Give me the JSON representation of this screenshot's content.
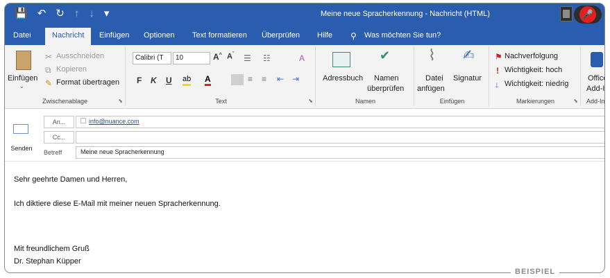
{
  "window": {
    "title": "Meine neue Spracherkennung - Nachricht (HTML)",
    "qat": {
      "save_icon": "💾",
      "undo_icon": "↶",
      "redo_icon": "↻",
      "up_icon": "↑",
      "down_icon": "↓",
      "more_icon": "▾"
    },
    "mic_icon": "🎤"
  },
  "tabs": [
    {
      "label": "Datei"
    },
    {
      "label": "Nachricht"
    },
    {
      "label": "Einfügen"
    },
    {
      "label": "Optionen"
    },
    {
      "label": "Text formatieren"
    },
    {
      "label": "Überprüfen"
    },
    {
      "label": "Hilfe"
    },
    {
      "label": "Was möchten Sie tun?"
    }
  ],
  "ribbon": {
    "clipboard": {
      "paste": "Einfügen",
      "cut": "Ausschneiden",
      "copy": "Kopieren",
      "format": "Format übertragen",
      "group": "Zwischenablage"
    },
    "text": {
      "font": "Calibri (T",
      "size": "10",
      "bold": "F",
      "italic": "K",
      "underline": "U",
      "group": "Text"
    },
    "names": {
      "addressbook": "Adressbuch",
      "check_line1": "Namen",
      "check_line2": "überprüfen",
      "group": "Namen"
    },
    "include": {
      "attach_line1": "Datei",
      "attach_line2": "anfügen",
      "signature": "Signatur",
      "group": "Einfügen"
    },
    "tags": {
      "followup": "Nachverfolgung",
      "high": "Wichtigkeit: hoch",
      "low": "Wichtigkeit: niedrig",
      "group": "Markierungen"
    },
    "addins": {
      "line1": "Office",
      "line2": "Add-In",
      "group": "Add-In"
    }
  },
  "header": {
    "send": "Senden",
    "to_button": "An...",
    "cc_button": "Cc...",
    "subject_label": "Betreff",
    "to_value": "info@nuance.com",
    "cc_value": "",
    "subject_value": "Meine neue Spracherkennung"
  },
  "body": {
    "line1": "Sehr geehrte Damen und Herren,",
    "line2": "Ich diktiere diese E-Mail mit meiner neuen Spracherkennung.",
    "line3": "Mit freundlichem Gruß",
    "line4": "Dr. Stephan Küpper"
  },
  "watermark": "BEISPIEL",
  "colors": {
    "accent": "#2a5db0",
    "ribbon_bg": "#f3f3f3",
    "mic": "#e02020"
  }
}
